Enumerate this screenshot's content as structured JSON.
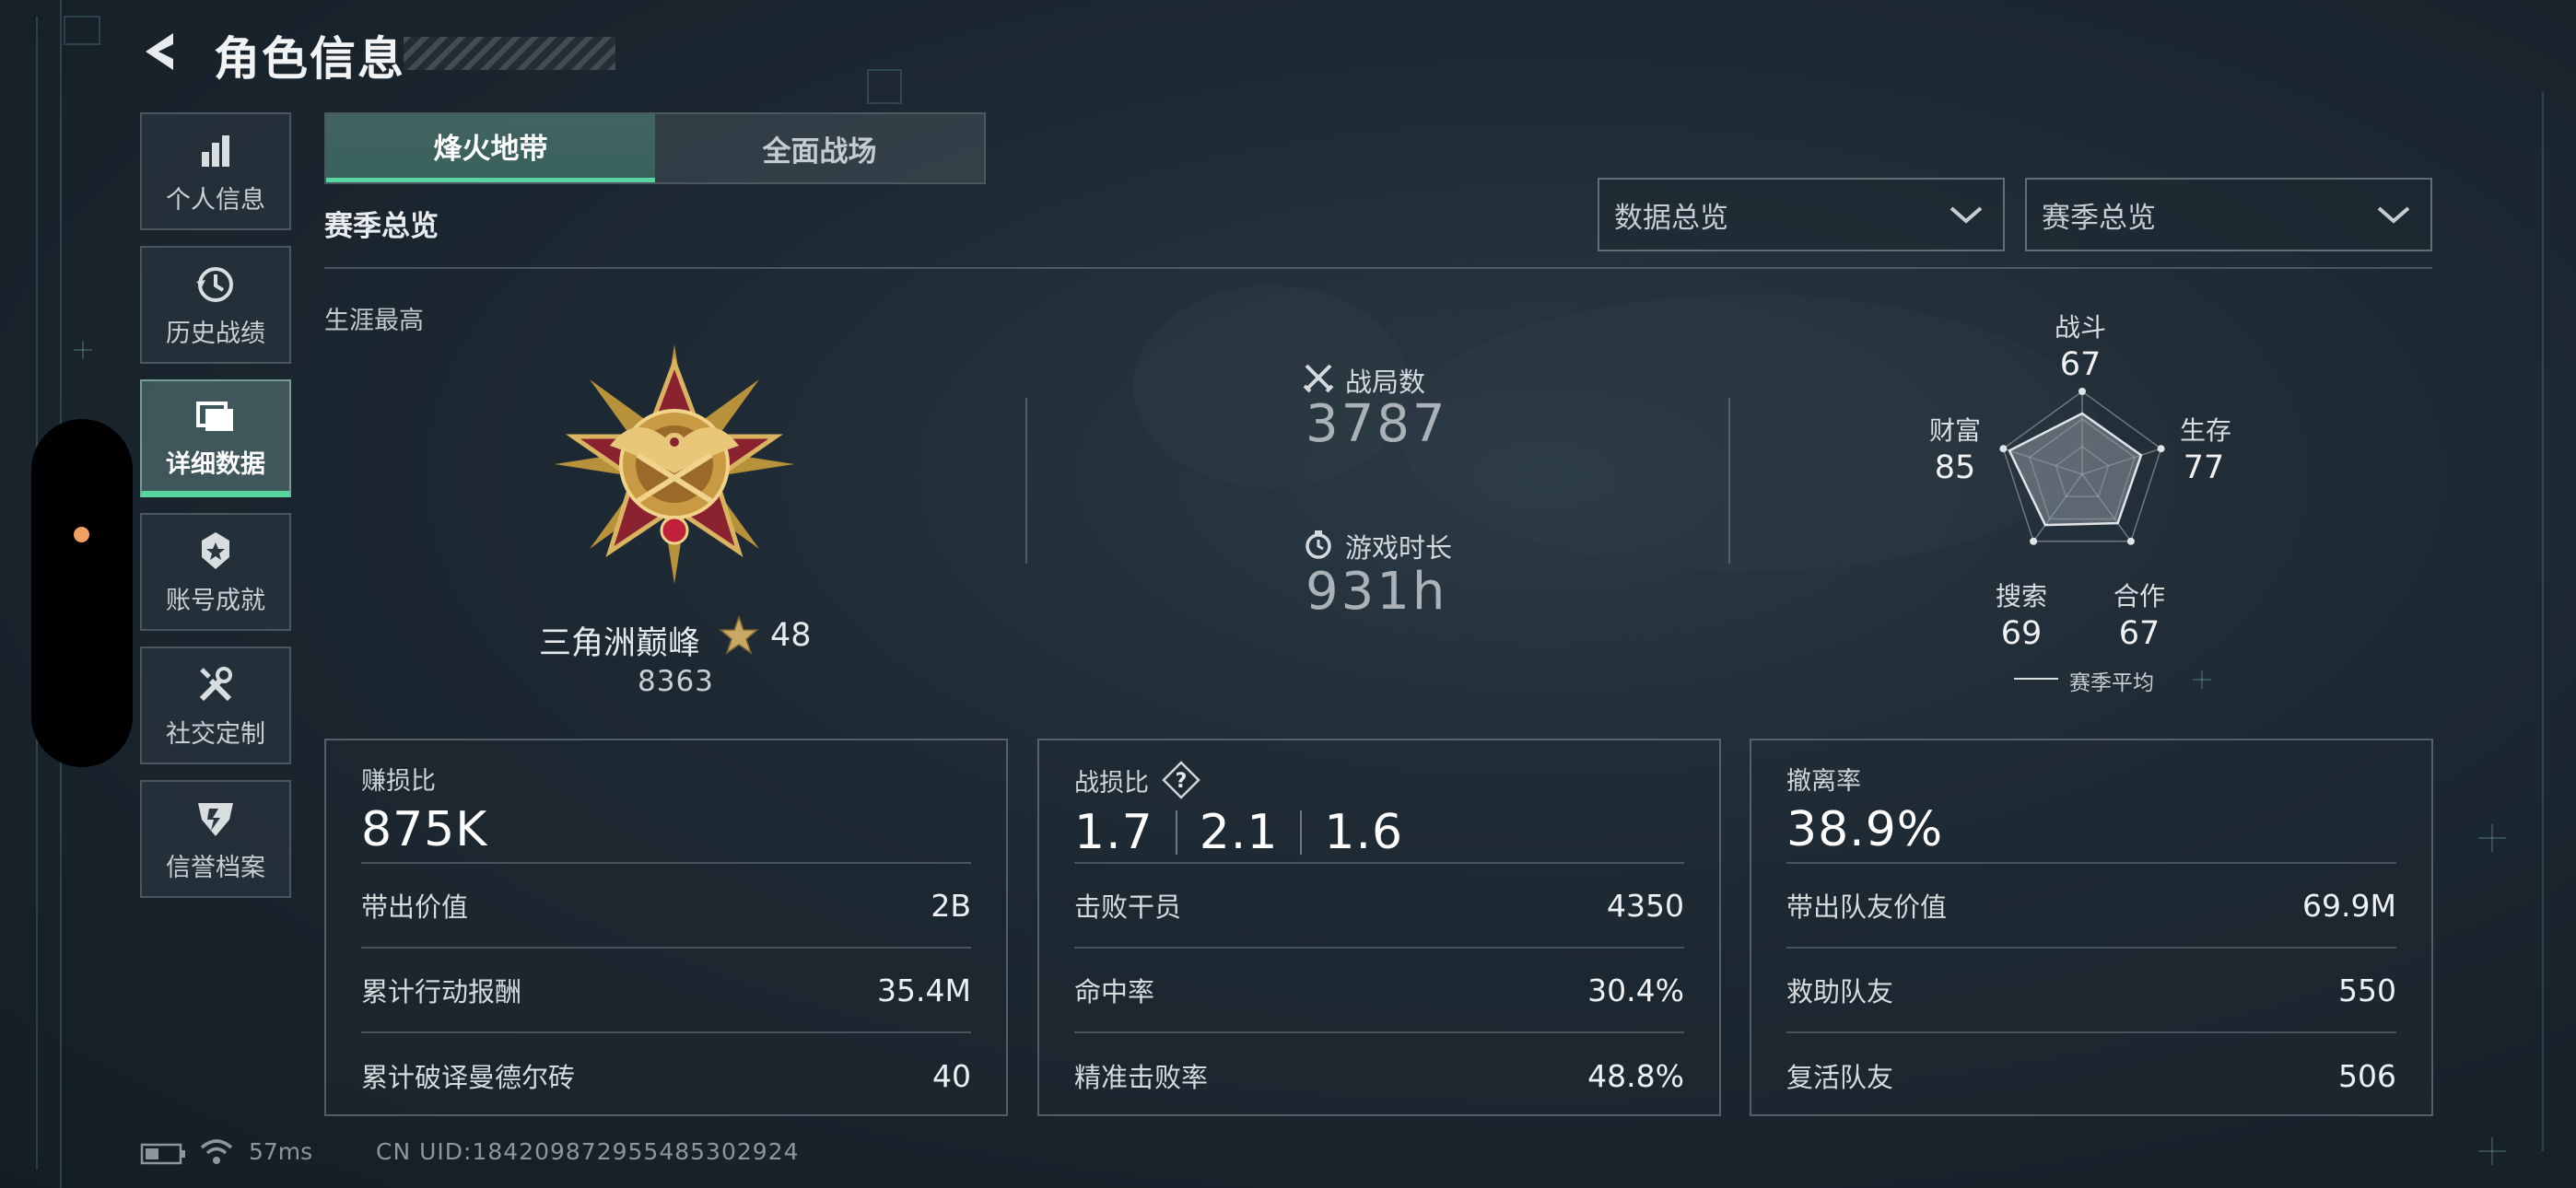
{
  "header": {
    "title": "角色信息"
  },
  "sidebar": {
    "items": [
      {
        "label": "个人信息",
        "icon": "bar-chart-icon",
        "active": false
      },
      {
        "label": "历史战绩",
        "icon": "history-icon",
        "active": false
      },
      {
        "label": "详细数据",
        "icon": "detail-data-icon",
        "active": true
      },
      {
        "label": "账号成就",
        "icon": "achievement-icon",
        "active": false
      },
      {
        "label": "社交定制",
        "icon": "tools-icon",
        "active": false
      },
      {
        "label": "信誉档案",
        "icon": "credit-shield-icon",
        "active": false
      }
    ]
  },
  "tabs": [
    {
      "label": "烽火地带",
      "active": true
    },
    {
      "label": "全面战场",
      "active": false
    }
  ],
  "section": {
    "title": "赛季总览",
    "career_label": "生涯最高"
  },
  "dropdowns": [
    {
      "value": "数据总览"
    },
    {
      "value": "赛季总览"
    }
  ],
  "rank": {
    "name": "三角洲巅峰",
    "level": "48",
    "points": "8363"
  },
  "summary": {
    "battles_label": "战局数",
    "battles_value": "3787",
    "time_label": "游戏时长",
    "time_value": "931h"
  },
  "radar": {
    "axes": [
      {
        "label": "战斗",
        "value": "67"
      },
      {
        "label": "生存",
        "value": "77"
      },
      {
        "label": "合作",
        "value": "67"
      },
      {
        "label": "搜索",
        "value": "69"
      },
      {
        "label": "财富",
        "value": "85"
      }
    ],
    "legend": "赛季平均"
  },
  "panels": {
    "profit": {
      "label": "赚损比",
      "value": "875K",
      "rows": [
        {
          "label": "带出价值",
          "value": "2B"
        },
        {
          "label": "累计行动报酬",
          "value": "35.4M"
        },
        {
          "label": "累计破译曼德尔砖",
          "value": "40"
        }
      ]
    },
    "kd": {
      "label": "战损比",
      "values": [
        "1.7",
        "2.1",
        "1.6"
      ],
      "rows": [
        {
          "label": "击败干员",
          "value": "4350"
        },
        {
          "label": "命中率",
          "value": "30.4%"
        },
        {
          "label": "精准击败率",
          "value": "48.8%"
        }
      ]
    },
    "extract": {
      "label": "撤离率",
      "value": "38.9%",
      "rows": [
        {
          "label": "带出队友价值",
          "value": "69.9M"
        },
        {
          "label": "救助队友",
          "value": "550"
        },
        {
          "label": "复活队友",
          "value": "506"
        }
      ]
    }
  },
  "footer": {
    "ping": "57ms",
    "uid": "CN UID:18420987295548530292​4"
  },
  "colors": {
    "accent": "#58d4a0",
    "dot": "#f0a060"
  }
}
